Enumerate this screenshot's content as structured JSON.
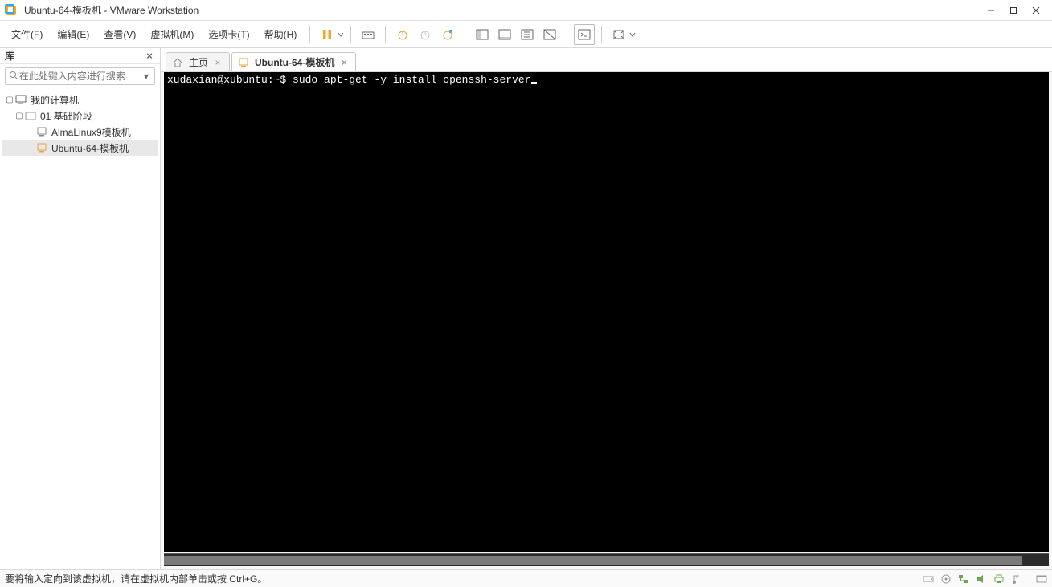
{
  "window": {
    "title": "Ubuntu-64-模板机 - VMware Workstation"
  },
  "menu": {
    "items": [
      "文件(F)",
      "编辑(E)",
      "查看(V)",
      "虚拟机(M)",
      "选项卡(T)",
      "帮助(H)"
    ]
  },
  "sidebar": {
    "title": "库",
    "search_placeholder": "在此处键入内容进行搜索",
    "root": {
      "label": "我的计算机",
      "children": [
        {
          "label": "01 基础阶段",
          "children": [
            {
              "label": "AlmaLinux9模板机"
            },
            {
              "label": "Ubuntu-64-模板机",
              "selected": true
            }
          ]
        }
      ]
    }
  },
  "tabs": {
    "home_label": "主页",
    "active_label": "Ubuntu-64-模板机"
  },
  "terminal": {
    "prompt": "xudaxian@xubuntu:~$ ",
    "command": "sudo apt-get -y install openssh-server"
  },
  "statusbar": {
    "message": "要将输入定向到该虚拟机，请在虚拟机内部单击或按 Ctrl+G。"
  }
}
